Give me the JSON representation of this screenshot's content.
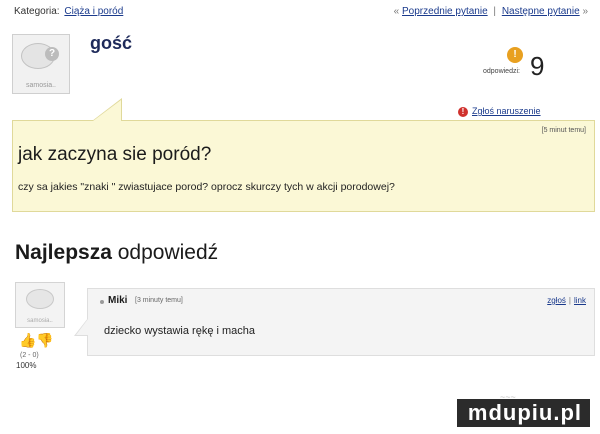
{
  "breadcrumb": {
    "label": "Kategoria:",
    "category": "Ciąża i poród"
  },
  "nav": {
    "prev_arrow": "«",
    "prev_label": "Poprzednie pytanie",
    "separator": "|",
    "next_label": "Następne pytanie",
    "next_arrow": "»"
  },
  "question": {
    "author": "gość",
    "avatar_caption": "samosia..",
    "answers_label": "odpowiedzi:",
    "answers_count": "9",
    "report_label": "Zgłoś naruszenie",
    "time": "[5 minut temu]",
    "title": "jak zaczyna sie poród?",
    "body": "czy sa jakies \"znaki \" zwiastujace porod? oprocz skurczy tych w akcji porodowej?"
  },
  "best_answer": {
    "heading_bold": "Najlepsza",
    "heading_rest": " odpowiedź",
    "avatar_caption": "samosia..",
    "author": "Miki",
    "time": "[3 minuty temu]",
    "report_link": "zgłoś",
    "link_label": "link",
    "link_separator": "|",
    "text": "dziecko wystawia rękę i macha",
    "votes": "(2 - 0)",
    "percent": "100%"
  },
  "watermark": {
    "text": "mdupiu.pl",
    "ghost": "~~~"
  },
  "colors": {
    "question_bg": "#fbf8d6",
    "answer_bg": "#f4f4f4",
    "link": "#1a3a8c",
    "answers_icon": "#e8a020",
    "report_icon": "#d0312d"
  }
}
